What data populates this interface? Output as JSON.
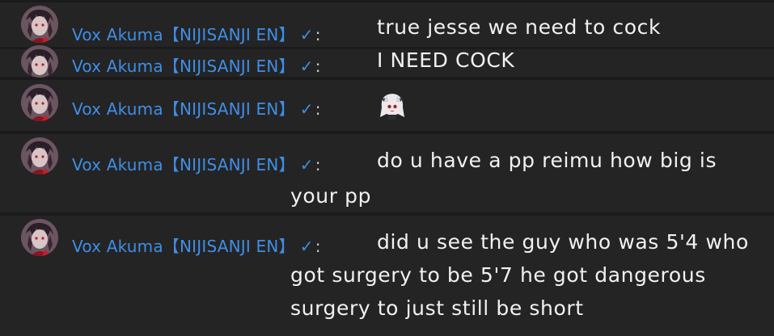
{
  "chat": {
    "messages": [
      {
        "author": "Vox Akuma【NIJISANJI EN】",
        "verified": "✓",
        "separator": ":",
        "text": "true jesse we need to cock"
      },
      {
        "author": "Vox Akuma【NIJISANJI EN】",
        "verified": "✓",
        "separator": ":",
        "text": "I NEED COCK"
      },
      {
        "author": "Vox Akuma【NIJISANJI EN】",
        "verified": "✓",
        "separator": ":",
        "emote": "anime-girl-emote"
      },
      {
        "author": "Vox Akuma【NIJISANJI EN】",
        "verified": "✓",
        "separator": ":",
        "text_lines": [
          "do u have a pp reimu how big is",
          "your pp"
        ]
      },
      {
        "author": "Vox Akuma【NIJISANJI EN】",
        "verified": "✓",
        "separator": ":",
        "text_lines": [
          "did u see the guy who was 5'4 who",
          "got surgery to be 5'7 he got dangerous",
          "surgery to just still be short"
        ]
      }
    ]
  },
  "icons": {
    "avatar": "avatar-portrait-icon",
    "verified": "verified-checkmark-icon",
    "emote": "anime-girl-emote"
  },
  "colors": {
    "background": "#1b1b1b",
    "row": "#242424",
    "author": "#3f8ee6",
    "text": "#f1f1f1"
  }
}
